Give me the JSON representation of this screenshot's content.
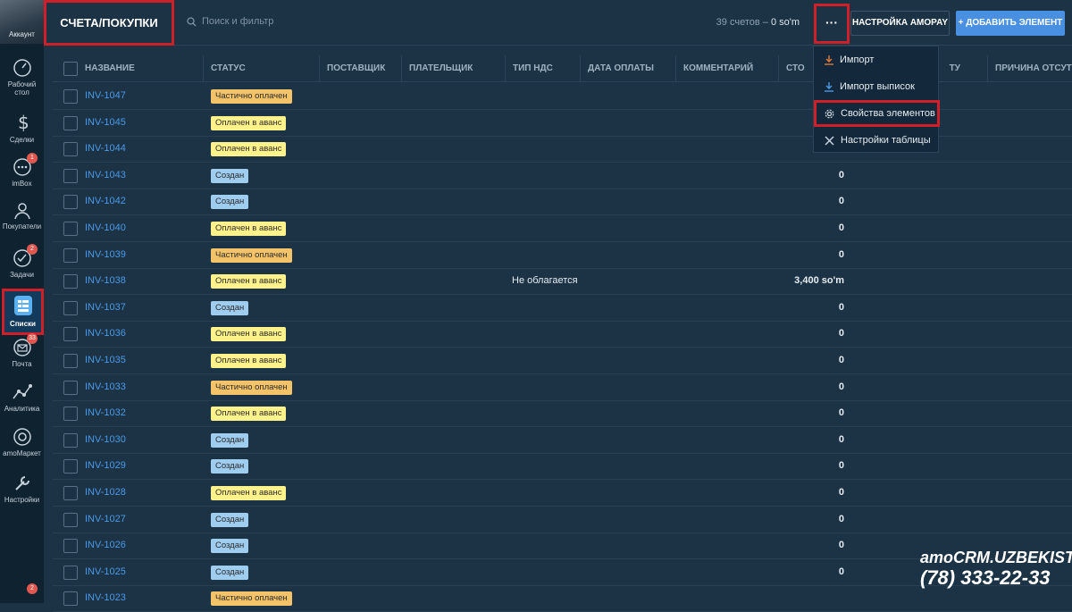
{
  "sidebar": {
    "account": "Аккаунт",
    "items": [
      {
        "label": "Рабочий стол",
        "icon": "dashboard-icon"
      },
      {
        "label": "Сделки",
        "icon": "dollar-icon"
      },
      {
        "label": "imBox",
        "icon": "chat-icon",
        "badge": "1"
      },
      {
        "label": "Покупатели",
        "icon": "customers-icon"
      },
      {
        "label": "Задачи",
        "icon": "tasks-icon",
        "badge": "2"
      },
      {
        "label": "Списки",
        "icon": "lists-icon"
      },
      {
        "label": "Почта",
        "icon": "mail-icon",
        "badge": "33"
      },
      {
        "label": "Аналитика",
        "icon": "analytics-icon"
      },
      {
        "label": "amoМаркет",
        "icon": "market-icon"
      },
      {
        "label": "Настройки",
        "icon": "settings-icon"
      }
    ],
    "bottom_badge": "2"
  },
  "header": {
    "title": "СЧЕТА/ПОКУПКИ",
    "search_placeholder": "Поиск и фильтр",
    "count_text": "39 счетов –",
    "count_sum": "0 so'm",
    "more": "···",
    "amopay": "НАСТРОЙКА AMOPAY",
    "add": "+ ДОБАВИТЬ ЭЛЕМЕНТ"
  },
  "columns": [
    "НАЗВАНИЕ",
    "СТАТУС",
    "ПОСТАВЩИК",
    "ПЛАТЕЛЬЩИК",
    "ТИП НДС",
    "ДАТА ОПЛАТЫ",
    "КОММЕНТАРИЙ",
    "СТО",
    "",
    "ТУ",
    "ПРИЧИНА ОТСУТ"
  ],
  "statuses": {
    "partial": {
      "label": "Частично оплачен",
      "color": "#f3c36a"
    },
    "advance": {
      "label": "Оплачен в аванс",
      "color": "#fff28a"
    },
    "created": {
      "label": "Создан",
      "color": "#9fcdf0"
    }
  },
  "rows": [
    {
      "name": "INV-1047",
      "status": "Частично оплачен",
      "type": "partial",
      "nds": "",
      "cost": ""
    },
    {
      "name": "INV-1045",
      "status": "Оплачен в аванс",
      "type": "advance",
      "nds": "",
      "cost": ""
    },
    {
      "name": "INV-1044",
      "status": "Оплачен в аванс",
      "type": "advance",
      "nds": "",
      "cost": ""
    },
    {
      "name": "INV-1043",
      "status": "Создан",
      "type": "created",
      "nds": "",
      "cost": "0"
    },
    {
      "name": "INV-1042",
      "status": "Создан",
      "type": "created",
      "nds": "",
      "cost": "0"
    },
    {
      "name": "INV-1040",
      "status": "Оплачен в аванс",
      "type": "advance",
      "nds": "",
      "cost": "0"
    },
    {
      "name": "INV-1039",
      "status": "Частично оплачен",
      "type": "partial",
      "nds": "",
      "cost": "0"
    },
    {
      "name": "INV-1038",
      "status": "Оплачен в аванс",
      "type": "advance",
      "nds": "Не облагается",
      "cost": "3,400 so'm"
    },
    {
      "name": "INV-1037",
      "status": "Создан",
      "type": "created",
      "nds": "",
      "cost": "0"
    },
    {
      "name": "INV-1036",
      "status": "Оплачен в аванс",
      "type": "advance",
      "nds": "",
      "cost": "0"
    },
    {
      "name": "INV-1035",
      "status": "Оплачен в аванс",
      "type": "advance",
      "nds": "",
      "cost": "0"
    },
    {
      "name": "INV-1033",
      "status": "Частично оплачен",
      "type": "partial",
      "nds": "",
      "cost": "0"
    },
    {
      "name": "INV-1032",
      "status": "Оплачен в аванс",
      "type": "advance",
      "nds": "",
      "cost": "0"
    },
    {
      "name": "INV-1030",
      "status": "Создан",
      "type": "created",
      "nds": "",
      "cost": "0"
    },
    {
      "name": "INV-1029",
      "status": "Создан",
      "type": "created",
      "nds": "",
      "cost": "0"
    },
    {
      "name": "INV-1028",
      "status": "Оплачен в аванс",
      "type": "advance",
      "nds": "",
      "cost": "0"
    },
    {
      "name": "INV-1027",
      "status": "Создан",
      "type": "created",
      "nds": "",
      "cost": "0"
    },
    {
      "name": "INV-1026",
      "status": "Создан",
      "type": "created",
      "nds": "",
      "cost": "0"
    },
    {
      "name": "INV-1025",
      "status": "Создан",
      "type": "created",
      "nds": "",
      "cost": "0"
    },
    {
      "name": "INV-1023",
      "status": "Частично оплачен",
      "type": "partial",
      "nds": "",
      "cost": ""
    }
  ],
  "menu": [
    {
      "label": "Импорт",
      "icon": "download-icon"
    },
    {
      "label": "Импорт выписок",
      "icon": "download-icon"
    },
    {
      "label": "Свойства элементов",
      "icon": "gear-icon"
    },
    {
      "label": "Настройки таблицы",
      "icon": "tools-icon"
    }
  ],
  "watermark": {
    "brand": "amoCRM.UZBEKISTAN",
    "phone": "(78) 333-22-33"
  }
}
